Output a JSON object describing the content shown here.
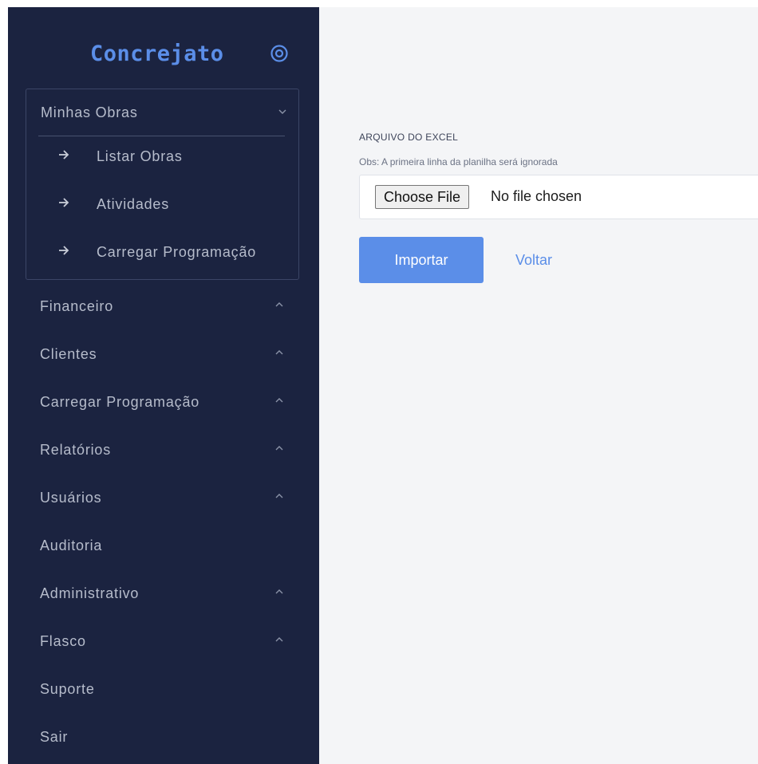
{
  "sidebar": {
    "brand": "Concrejato",
    "brand_icon": "target-icon",
    "group": {
      "label": "Minhas Obras",
      "items": [
        {
          "label": "Listar Obras"
        },
        {
          "label": "Atividades"
        },
        {
          "label": "Carregar Programação"
        }
      ]
    },
    "items": [
      {
        "label": "Financeiro",
        "chevron": true
      },
      {
        "label": "Clientes",
        "chevron": true
      },
      {
        "label": "Carregar Programação",
        "chevron": true
      },
      {
        "label": "Relatórios",
        "chevron": true
      },
      {
        "label": "Usuários",
        "chevron": true
      },
      {
        "label": "Auditoria",
        "chevron": false
      },
      {
        "label": "Administrativo",
        "chevron": true
      },
      {
        "label": "Flasco",
        "chevron": true
      },
      {
        "label": "Suporte",
        "chevron": false
      },
      {
        "label": "Sair",
        "chevron": false
      }
    ]
  },
  "main": {
    "field_label": "ARQUIVO DO EXCEL",
    "field_hint": "Obs: A primeira linha da planilha será ignorada",
    "file_button": "Choose File",
    "file_status": "No file chosen",
    "import_button": "Importar",
    "back_link": "Voltar"
  },
  "colors": {
    "sidebar_bg": "#1b2340",
    "accent": "#5b8ee8",
    "main_bg": "#f4f5f7"
  }
}
